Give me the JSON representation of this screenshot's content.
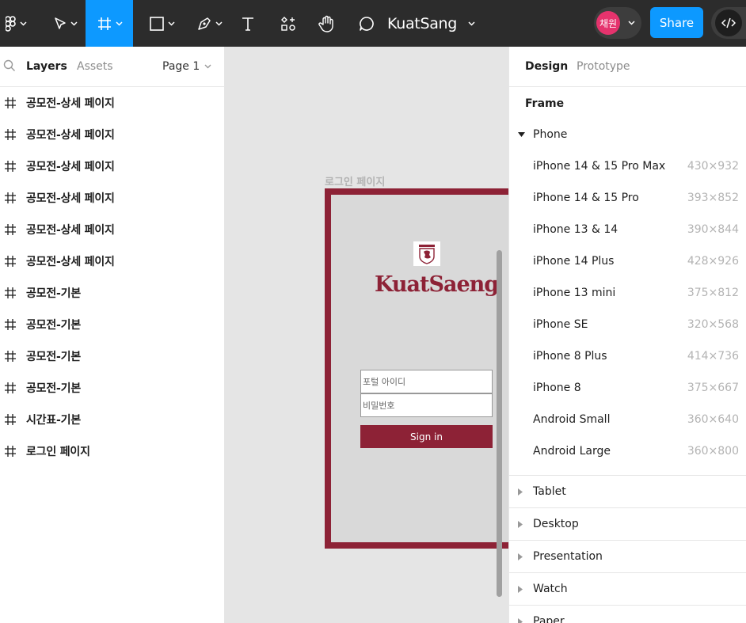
{
  "toolbar": {
    "file_name": "KuatSang",
    "avatar_text": "채원",
    "share_label": "Share",
    "accent": "#0d99ff"
  },
  "left_panel": {
    "tabs": [
      {
        "label": "Layers",
        "active": true
      },
      {
        "label": "Assets",
        "active": false
      }
    ],
    "page_label": "Page 1",
    "layers": [
      {
        "label": "공모전-상세 페이지"
      },
      {
        "label": "공모전-상세 페이지"
      },
      {
        "label": "공모전-상세 페이지"
      },
      {
        "label": "공모전-상세 페이지"
      },
      {
        "label": "공모전-상세 페이지"
      },
      {
        "label": "공모전-상세 페이지"
      },
      {
        "label": "공모전-기본"
      },
      {
        "label": "공모전-기본"
      },
      {
        "label": "공모전-기본"
      },
      {
        "label": "공모전-기본"
      },
      {
        "label": "시간표-기본"
      },
      {
        "label": "로그인 페이지"
      }
    ]
  },
  "canvas": {
    "frame_title": "로그인 페이지",
    "brand": "KuatSaeng",
    "brand_color": "#8d2236",
    "id_placeholder": "포털 아이디",
    "pw_placeholder": "비밀번호",
    "sign_in_label": "Sign in"
  },
  "right_panel": {
    "tabs": [
      {
        "label": "Design",
        "active": true
      },
      {
        "label": "Prototype",
        "active": false
      }
    ],
    "section_title": "Frame",
    "phone_group": "Phone",
    "phone_presets": [
      {
        "name": "iPhone 14 & 15 Pro Max",
        "size": "430×932"
      },
      {
        "name": "iPhone 14 & 15 Pro",
        "size": "393×852"
      },
      {
        "name": "iPhone 13 & 14",
        "size": "390×844"
      },
      {
        "name": "iPhone 14 Plus",
        "size": "428×926"
      },
      {
        "name": "iPhone 13 mini",
        "size": "375×812"
      },
      {
        "name": "iPhone SE",
        "size": "320×568"
      },
      {
        "name": "iPhone 8 Plus",
        "size": "414×736"
      },
      {
        "name": "iPhone 8",
        "size": "375×667"
      },
      {
        "name": "Android Small",
        "size": "360×640"
      },
      {
        "name": "Android Large",
        "size": "360×800"
      }
    ],
    "collapsed_groups": [
      "Tablet",
      "Desktop",
      "Presentation",
      "Watch",
      "Paper"
    ]
  }
}
